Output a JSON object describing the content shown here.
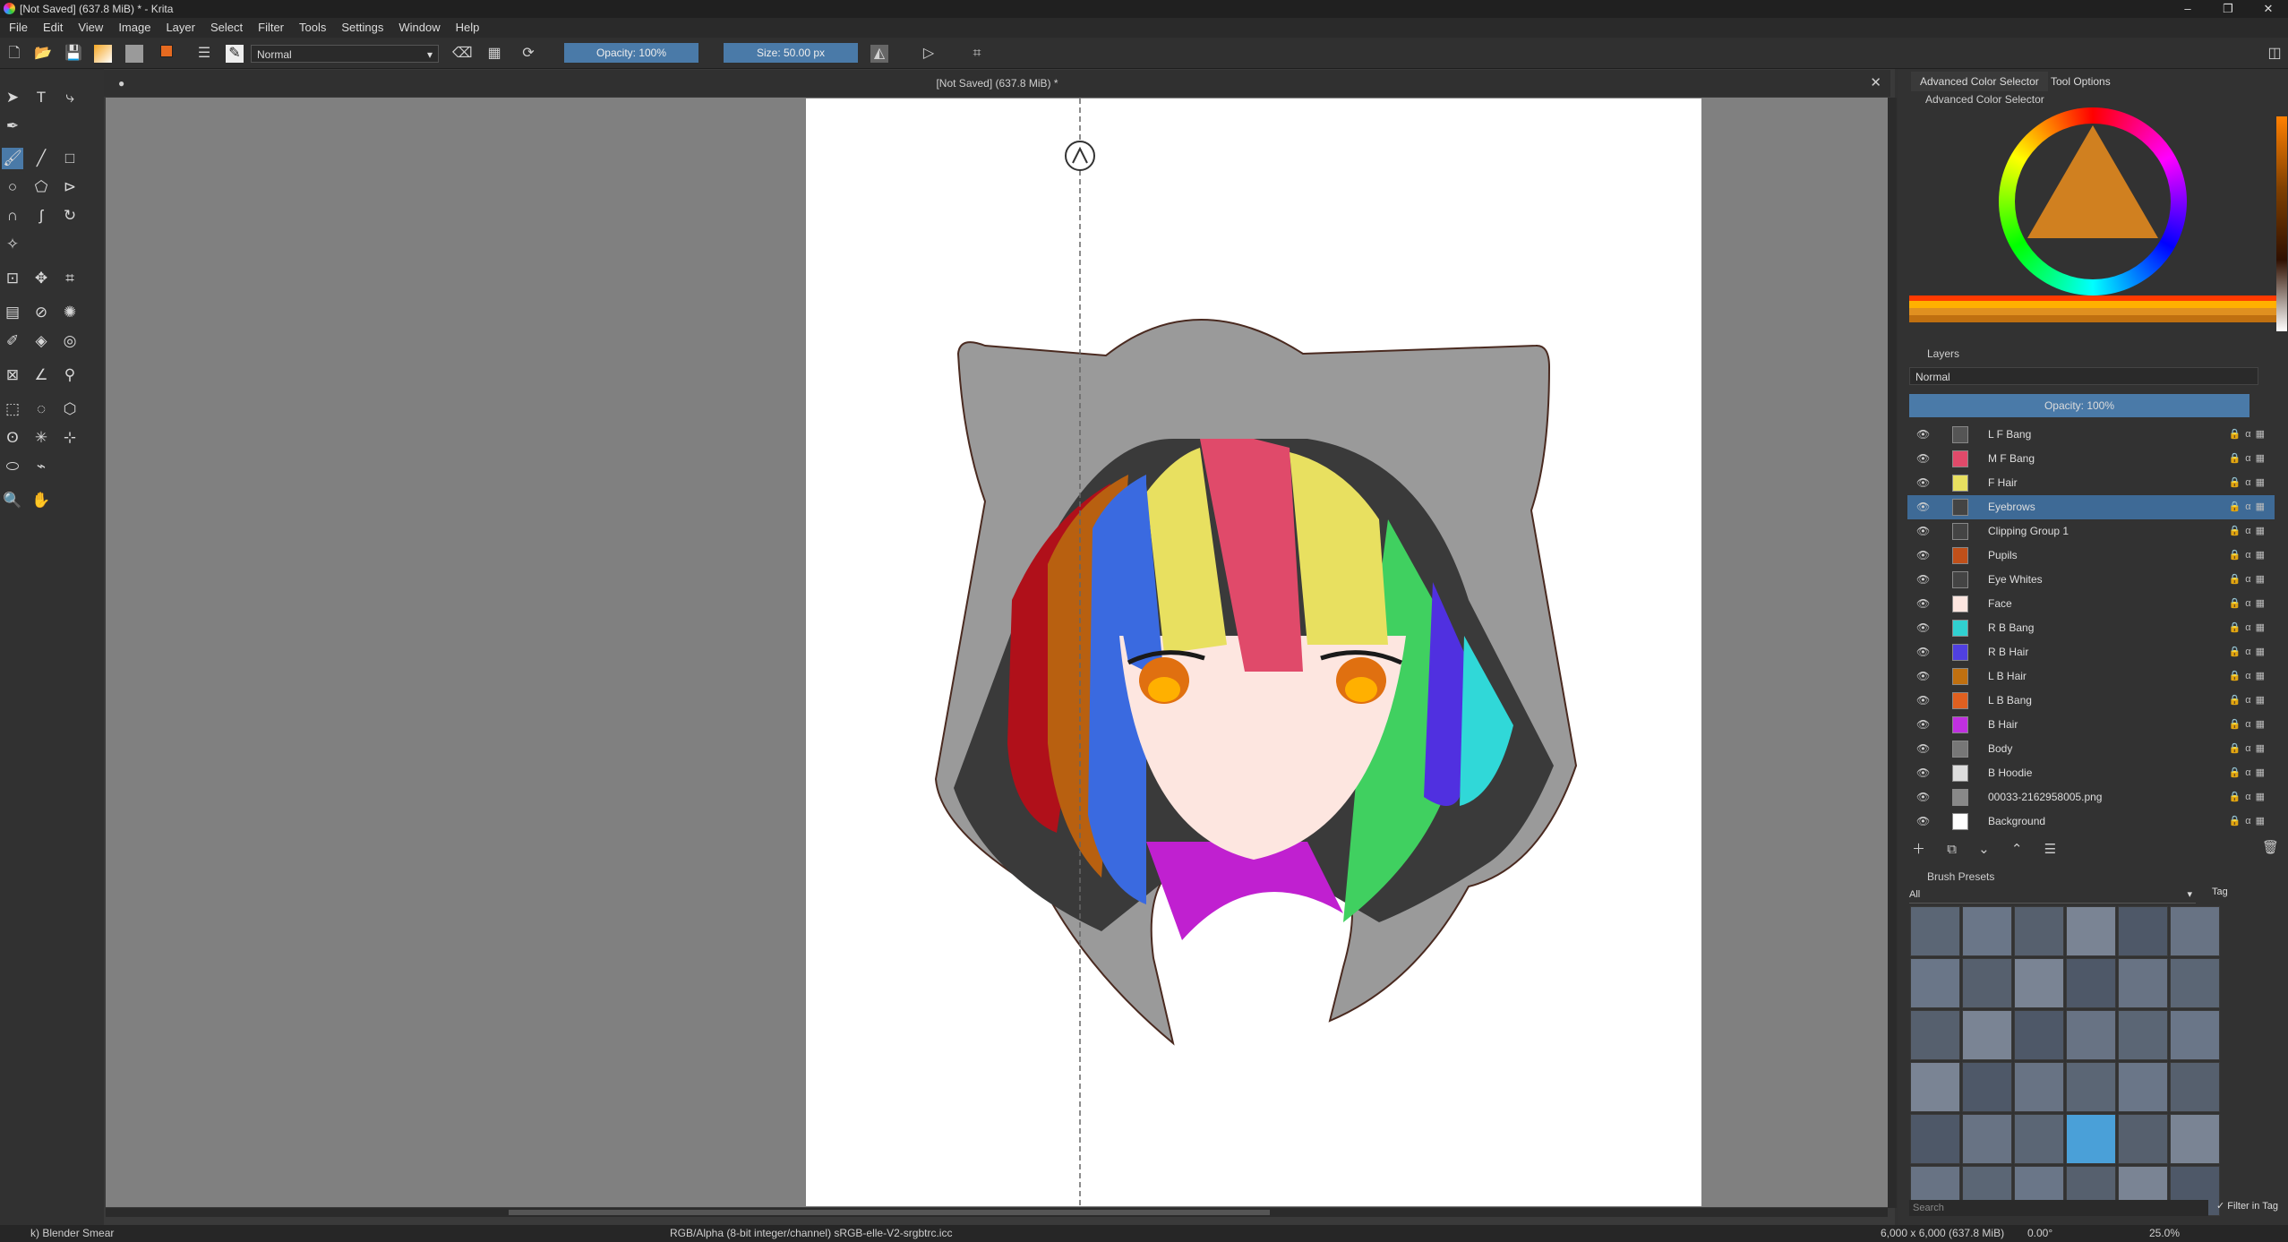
{
  "window": {
    "title": "[Not Saved]  (637.8 MiB) * - Krita"
  },
  "menu": [
    "File",
    "Edit",
    "View",
    "Image",
    "Layer",
    "Select",
    "Filter",
    "Tools",
    "Settings",
    "Window",
    "Help"
  ],
  "toolbar": {
    "blend_mode": "Normal",
    "opacity": "Opacity: 100%",
    "size": "Size: 50.00 px"
  },
  "document": {
    "tab_title": "[Not Saved]  (637.8 MiB) *"
  },
  "dock_tabs": {
    "color_selector": "Advanced Color Selector",
    "tool_options": "Tool Options"
  },
  "color_panel": {
    "title": "Advanced Color Selector"
  },
  "layers": {
    "title": "Layers",
    "blend": "Normal",
    "opacity": "Opacity:  100%",
    "items": [
      {
        "name": "L F Bang",
        "thumb": "#555"
      },
      {
        "name": "M F Bang",
        "thumb": "#e04a6a"
      },
      {
        "name": "F Hair",
        "thumb": "#e8e060"
      },
      {
        "name": "Eyebrows",
        "thumb": "#444"
      },
      {
        "name": "Clipping Group 1",
        "thumb": "#444"
      },
      {
        "name": "Pupils",
        "thumb": "#c0501a"
      },
      {
        "name": "Eye Whites",
        "thumb": "#444"
      },
      {
        "name": "Face",
        "thumb": "#fde6e0"
      },
      {
        "name": "R B Bang",
        "thumb": "#30d0d0"
      },
      {
        "name": "R B Hair",
        "thumb": "#5040e0"
      },
      {
        "name": "L B Hair",
        "thumb": "#c07010"
      },
      {
        "name": "L B Bang",
        "thumb": "#e06020"
      },
      {
        "name": "B Hair",
        "thumb": "#c030e0"
      },
      {
        "name": "Body",
        "thumb": "#777"
      },
      {
        "name": "B Hoodie",
        "thumb": "#ddd"
      },
      {
        "name": "00033-2162958005.png",
        "thumb": "#888"
      },
      {
        "name": "Background",
        "thumb": "#ffffff"
      }
    ]
  },
  "brush_presets": {
    "title": "Brush Presets",
    "filter": "All",
    "tag": "Tag",
    "search_placeholder": "Search",
    "filter_in_tag": "Filter in Tag"
  },
  "status": {
    "brush": "k) Blender Smear",
    "color_info": "RGB/Alpha (8-bit integer/channel)  sRGB-elle-V2-srgbtrc.icc",
    "dimensions": "6,000 x 6,000 (637.8 MiB)",
    "rotation": "0.00°",
    "zoom": "25.0%"
  },
  "colors": {
    "accent": "#4a7aa8",
    "selected_layer": "#3e6a96"
  }
}
